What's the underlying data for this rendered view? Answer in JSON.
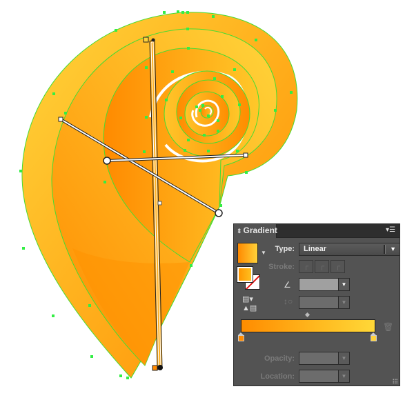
{
  "colors": {
    "gradient_start": "#ff8a00",
    "gradient_end": "#ffd23a",
    "anchor_green": "#33dd44",
    "panel_bg": "#535353"
  },
  "artwork": {
    "name": "spiral-shell-shape",
    "gradient_annotator": "gradient-slider-handles"
  },
  "panel": {
    "title": "Gradient",
    "collapse_icon": "updown-arrows-icon",
    "menu_icon": "panel-menu-icon",
    "type_label": "Type:",
    "type_value": "Linear",
    "stroke_label": "Stroke:",
    "stroke_buttons": [
      "stroke-within",
      "stroke-along",
      "stroke-across"
    ],
    "angle_value": "",
    "aspect_value": "",
    "stops": [
      {
        "color": "#ff8a00",
        "location_pct": 0
      },
      {
        "color": "#ffd23a",
        "location_pct": 100
      }
    ],
    "midpoint_pct": 50,
    "opacity_label": "Opacity:",
    "opacity_value": "",
    "location_label": "Location:",
    "location_value": ""
  }
}
